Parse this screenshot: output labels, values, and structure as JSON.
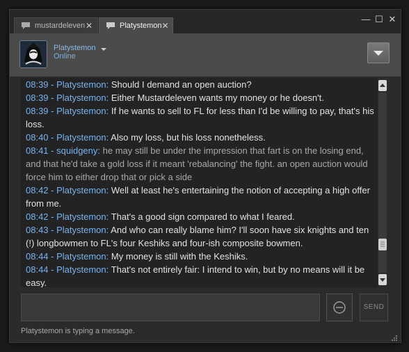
{
  "tabs": [
    {
      "label": "mustardeleven",
      "close": "✕"
    },
    {
      "label": "Platystemon",
      "close": "✕"
    }
  ],
  "window_controls": {
    "minimize": "—",
    "maximize": "☐",
    "close": "✕"
  },
  "header": {
    "username": "Platystemon",
    "status": "Online"
  },
  "messages": [
    {
      "time": "08:39",
      "sep": " - ",
      "author": "Platystemon",
      "colon": ": ",
      "text": "Should I demand an open auction?"
    },
    {
      "time": "08:39",
      "sep": " - ",
      "author": "Platystemon",
      "colon": ": ",
      "text": "Either Mustardeleven wants my money or he doesn't."
    },
    {
      "time": "08:39",
      "sep": " - ",
      "author": "Platystemon",
      "colon": ": ",
      "text": "If he wants to sell to FL for less than I'd be willing to pay, that's his loss."
    },
    {
      "time": "08:40",
      "sep": " - ",
      "author": "Platystemon",
      "colon": ": ",
      "text": "Also my loss, but his loss nonetheless."
    },
    {
      "time": "08:41",
      "sep": " - ",
      "author": "squidgeny",
      "colon": ": ",
      "text": "he may still be under the impression that fart is on the losing end, and that he'd take a gold loss if it meant 'rebalancing' the fight. an open auction would force him to either drop that or pick a side"
    },
    {
      "time": "08:42",
      "sep": " - ",
      "author": "Platystemon",
      "colon": ": ",
      "text": "Well at least he's entertaining the notion of accepting a high offer from me."
    },
    {
      "time": "08:42",
      "sep": " - ",
      "author": "Platystemon",
      "colon": ": ",
      "text": "That's a good sign compared to what I feared."
    },
    {
      "time": "08:43",
      "sep": " - ",
      "author": "Platystemon",
      "colon": ": ",
      "text": "And who can really blame him? I'll soon have six knights and ten (!) longbowmen to FL's four Keshiks and four-ish composite bowmen."
    },
    {
      "time": "08:44",
      "sep": " - ",
      "author": "Platystemon",
      "colon": ": ",
      "text": "My money is still with the Keshiks."
    },
    {
      "time": "08:44",
      "sep": " - ",
      "author": "Platystemon",
      "colon": ": ",
      "text": "That's not entirely fair: I intend to win, but by no means will it be easy."
    }
  ],
  "composer": {
    "send_label": "SEND"
  },
  "status_text": "Platystemon is typing a message.",
  "colors": {
    "link_blue": "#77b3f0",
    "friend_text": "#a8a8a8",
    "bg": "#2b2b2b"
  }
}
